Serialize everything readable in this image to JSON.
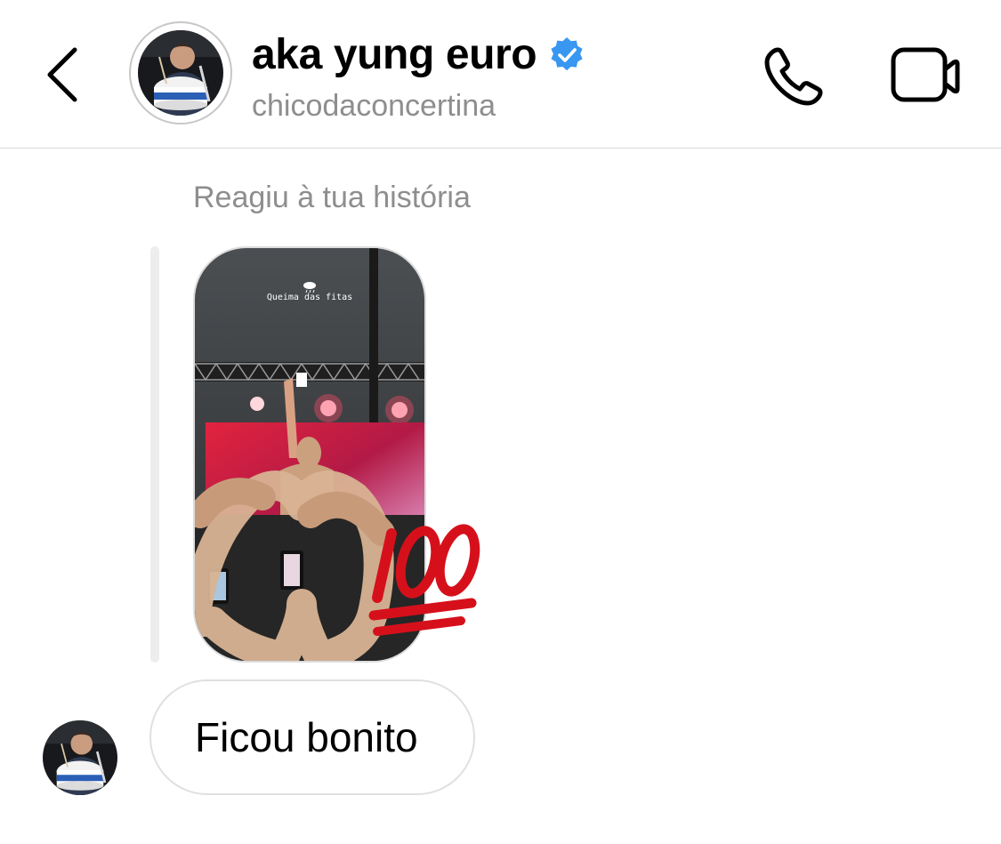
{
  "header": {
    "title": "aka yung euro",
    "subtitle": "chicodaconcertina",
    "verified": true,
    "icons": {
      "back": "chevron-left-icon",
      "call": "phone-icon",
      "video": "video-camera-icon",
      "verified": "verified-badge-icon"
    }
  },
  "conversation": {
    "reply_label": "Reagiu à tua história",
    "story": {
      "caption": "Queima das fitas",
      "sticker": "hundred-points-icon"
    },
    "message": {
      "text": "Ficou bonito"
    }
  },
  "colors": {
    "verified_blue": "#3897f0",
    "muted_text": "#8e8e8e",
    "divider": "#dbdbdb",
    "bubble_border": "#e0e0e0",
    "sticker_red": "#d6101b"
  }
}
